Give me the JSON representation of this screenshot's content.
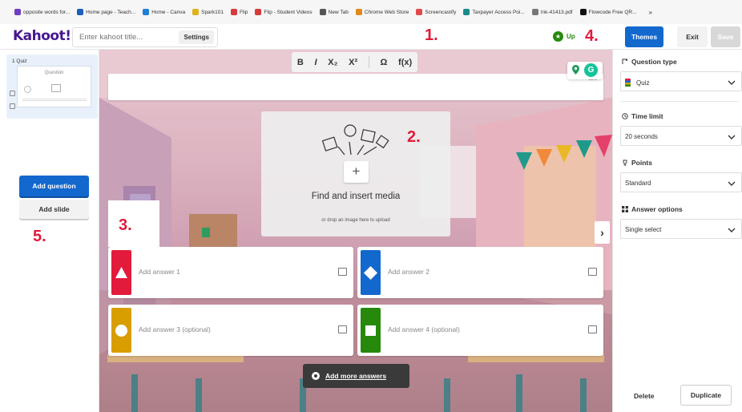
{
  "bookmarks": [
    {
      "label": "opposite words for...",
      "icon": "purple-square-icon",
      "color": "#6e3fbf"
    },
    {
      "label": "Home page - Teach...",
      "icon": "blue-bars-icon",
      "color": "#1b5fb8"
    },
    {
      "label": "Home - Canva",
      "icon": "canva-icon",
      "color": "#1e7fd6"
    },
    {
      "label": "Spark101",
      "icon": "yellow-grid-icon",
      "color": "#e0b21a"
    },
    {
      "label": "Flip",
      "icon": "flip-icon",
      "color": "#d83a3a"
    },
    {
      "label": "Flip - Student Videos",
      "icon": "flip-icon",
      "color": "#d83a3a"
    },
    {
      "label": "New Tab",
      "icon": "globe-icon",
      "color": "#555555"
    },
    {
      "label": "Chrome Web Store",
      "icon": "chrome-store-icon",
      "color": "#e08a1a"
    },
    {
      "label": "Screencastify",
      "icon": "screencastify-icon",
      "color": "#e04a4a"
    },
    {
      "label": "Taxpayer Access Poi...",
      "icon": "teal-circle-icon",
      "color": "#1a8a8a"
    },
    {
      "label": "Ink-41413.pdf",
      "icon": "link-icon",
      "color": "#777777"
    },
    {
      "label": "Flowcode Free QR...",
      "icon": "black-circle-icon",
      "color": "#111111"
    }
  ],
  "topbar": {
    "logo": "Kahoot!",
    "title_placeholder": "Enter kahoot title...",
    "settings": "Settings",
    "upgrade": "Up",
    "themes": "Themes",
    "exit": "Exit",
    "save": "Save"
  },
  "annotations": {
    "n1": "1.",
    "n2": "2.",
    "n3": "3.",
    "n4": "4.",
    "n5": "5."
  },
  "left": {
    "slide_label": "1  Quiz",
    "thumb_question": "Question",
    "add_question": "Add question",
    "add_slide": "Add slide"
  },
  "editor": {
    "format": [
      "B",
      "I",
      "X₂",
      "X²",
      "Ω",
      "f(x)"
    ],
    "question_placeholder": "",
    "char_count": "120",
    "media_title": "Find and insert media",
    "media_sub": "or drop an image here to upload",
    "plus": "+",
    "next": "›",
    "answers": [
      {
        "placeholder": "Add answer 1",
        "color": "#e21b3c",
        "shape": "triangle"
      },
      {
        "placeholder": "Add answer 2",
        "color": "#1368ce",
        "shape": "diamond"
      },
      {
        "placeholder": "Add answer 3 (optional)",
        "color": "#d89e00",
        "shape": "circle"
      },
      {
        "placeholder": "Add answer 4 (optional)",
        "color": "#26890c",
        "shape": "square"
      }
    ],
    "add_more": "Add more answers"
  },
  "right": {
    "question_type_label": "Question type",
    "question_type_value": "Quiz",
    "time_limit_label": "Time limit",
    "time_limit_value": "20 seconds",
    "points_label": "Points",
    "points_value": "Standard",
    "answer_options_label": "Answer options",
    "answer_options_value": "Single select",
    "delete": "Delete",
    "duplicate": "Duplicate"
  }
}
